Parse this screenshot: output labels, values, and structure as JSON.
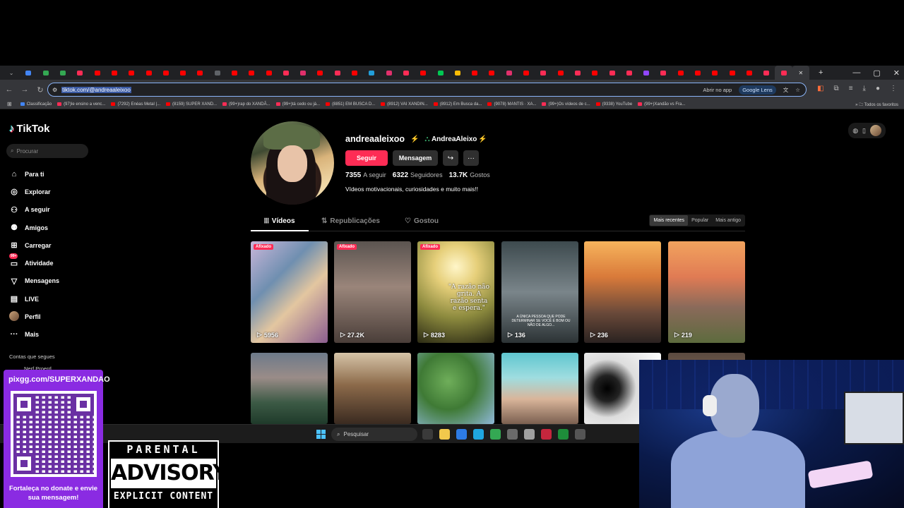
{
  "browser": {
    "url": "tiktok.com/@andreaalaleixoo",
    "url_display": "tiktok.com/@andreaaleixoo",
    "open_in_app": "Abrir no app",
    "google_lens": "Google Lens",
    "all_favorites": "Todos os favoritos",
    "bookmarks": [
      {
        "label": "Classificação",
        "color": "#4285f4"
      },
      {
        "label": "(97)Ie ensino a venc...",
        "color": "#fe2c55"
      },
      {
        "label": "(7292) Enéas Metal |...",
        "color": "#ff0000"
      },
      {
        "label": "(8159) SUPER XAND...",
        "color": "#ff0000"
      },
      {
        "label": "(99+)rap do XANDÃ...",
        "color": "#fe2c55"
      },
      {
        "label": "(99+)tá cedo ou já...",
        "color": "#fe2c55"
      },
      {
        "label": "(8851) EM BUSCA D...",
        "color": "#ff0000"
      },
      {
        "label": "(8912) VAI XANDIN...",
        "color": "#ff0000"
      },
      {
        "label": "(8912) Em Busca da...",
        "color": "#ff0000"
      },
      {
        "label": "(9078) MANTIS · XA...",
        "color": "#ff0000"
      },
      {
        "label": "(99+)Os vídeos de c...",
        "color": "#fe2c55"
      },
      {
        "label": "(9338) YouTube",
        "color": "#ff0000"
      },
      {
        "label": "(99+)Xandão vs Fra...",
        "color": "#fe2c55"
      }
    ],
    "tab_colors": [
      "#4285f4",
      "#34a853",
      "#34a853",
      "#fe2c55",
      "#ff0000",
      "#ff0000",
      "#ff0000",
      "#ff0000",
      "#ff0000",
      "#ff0000",
      "#ff0000",
      "#5f6368",
      "#ff0000",
      "#ff0000",
      "#ff0000",
      "#fe2c55",
      "#e1306c",
      "#ff0000",
      "#fe2c55",
      "#ff0000",
      "#229ed9",
      "#e1306c",
      "#fe2c55",
      "#ff0000",
      "#00c853",
      "#fbbc05",
      "#ff0000",
      "#ff0000",
      "#e1306c",
      "#ff0000",
      "#fe2c55",
      "#ff0000",
      "#fe2c55",
      "#ff0000",
      "#fe2c55",
      "#fe2c55",
      "#9146ff",
      "#fe2c55",
      "#ff0000",
      "#ff0000",
      "#ff0000",
      "#ff0000",
      "#ff0000",
      "#fe2c55",
      "#fe2c55"
    ]
  },
  "tiktok": {
    "brand": "TikTok",
    "search_placeholder": "Procurar",
    "nav": [
      {
        "label": "Para ti",
        "icon": "home-icon"
      },
      {
        "label": "Explorar",
        "icon": "compass-icon"
      },
      {
        "label": "A seguir",
        "icon": "following-icon"
      },
      {
        "label": "Amigos",
        "icon": "friends-icon"
      },
      {
        "label": "Carregar",
        "icon": "upload-icon"
      },
      {
        "label": "Atividade",
        "icon": "activity-icon",
        "badge": "99+"
      },
      {
        "label": "Mensagens",
        "icon": "messages-icon"
      },
      {
        "label": "LIVE",
        "icon": "live-icon"
      },
      {
        "label": "Perfil",
        "icon": "profile-avatar"
      },
      {
        "label": "Mais",
        "icon": "more-icon"
      }
    ],
    "follows_title": "Contas que segues",
    "follows_first": "Nerf Proerd"
  },
  "profile": {
    "username": "andreaaleixoo",
    "nickname": "AndreaAleixo",
    "follow_label": "Seguir",
    "message_label": "Mensagem",
    "stats": [
      {
        "value": "7355",
        "label": "A seguir"
      },
      {
        "value": "6322",
        "label": "Seguidores"
      },
      {
        "value": "13.7K",
        "label": "Gostos"
      }
    ],
    "bio": "Vídeos motivacionais, curiosidades e muito mais!!",
    "tabs": [
      "Vídeos",
      "Republicações",
      "Gostou"
    ],
    "sort": [
      "Mais recentes",
      "Popular",
      "Mais antigo"
    ],
    "pinned_label": "Afixado",
    "videos_row1": [
      {
        "views": "5956",
        "pinned": true,
        "bg": "linear-gradient(135deg,#c9b6d9 0%,#6f8fb0 35%,#e3c6a0 60%,#8a5c8f 100%)"
      },
      {
        "views": "27.2K",
        "pinned": true,
        "bg": "linear-gradient(180deg,#5b5450 0%,#9a857a 45%,#4a3e39 100%)"
      },
      {
        "views": "8283",
        "pinned": true,
        "bg": "radial-gradient(circle at 50% 25%,#fff6c9 0%,#e6cf7a 25%,#8c8a3e 60%,#2b2a14 100%)",
        "quote": "\"A razão não grita. A razão senta e espera.\""
      },
      {
        "views": "136",
        "pinned": false,
        "bg": "linear-gradient(180deg,#3d4a4e 0%,#7a858a 50%,#2c3335 100%)",
        "caption": "A ÚNICA PESSOA QUE PODE DETERMINAR SE VOCÊ É BOM OU NÃO DE ALGO..."
      },
      {
        "views": "236",
        "pinned": false,
        "bg": "linear-gradient(180deg,#f7b45c 0%,#d97a3a 35%,#6b4a3a 70%,#2a2220 100%)"
      },
      {
        "views": "219",
        "pinned": false,
        "bg": "linear-gradient(180deg,#f2a35e 0%,#e07b54 35%,#8a6a5a 65%,#5d6b3e 100%)"
      }
    ],
    "videos_row2_bg": [
      "linear-gradient(180deg,#6d7a8a 0%,#9a8c88 35%,#3c5a45 70%,#1f3a2a 100%)",
      "linear-gradient(180deg,#d6c4a8 0%,#8c6a4a 45%,#3a2a20 100%)",
      "radial-gradient(circle at 40% 40%,#6fae5a 0%,#3f7a35 45%,#8fb8d8 100%)",
      "linear-gradient(180deg,#5fc6cf 0%,#9fdde0 35%,#d9b59a 65%,#7a5f50 100%)",
      "radial-gradient(circle at 30% 50%,#000 0%,#222 20%,#ddd 45%,#fff 100%)",
      "linear-gradient(180deg,#5a4a40 0%,#8a6a55 50%,#3a2e28 100%)"
    ]
  },
  "taskbar": {
    "search_placeholder": "Pesquisar",
    "app_colors": [
      "#3a3a3a",
      "#f2c94c",
      "#2d7be5",
      "#1fa7e0",
      "#34a853",
      "#6a6a6a",
      "#a0a0a0",
      "#c6263d",
      "#1e8d3a",
      "#555555"
    ]
  },
  "overlay": {
    "donate_url": "pixgg.com/SUPERXANDAO",
    "donate_text": "Fortaleça no donate e envie sua mensagem!",
    "advisory_top": "PARENTAL",
    "advisory_mid": "ADVISORY",
    "advisory_bot": "EXPLICIT CONTENT"
  }
}
